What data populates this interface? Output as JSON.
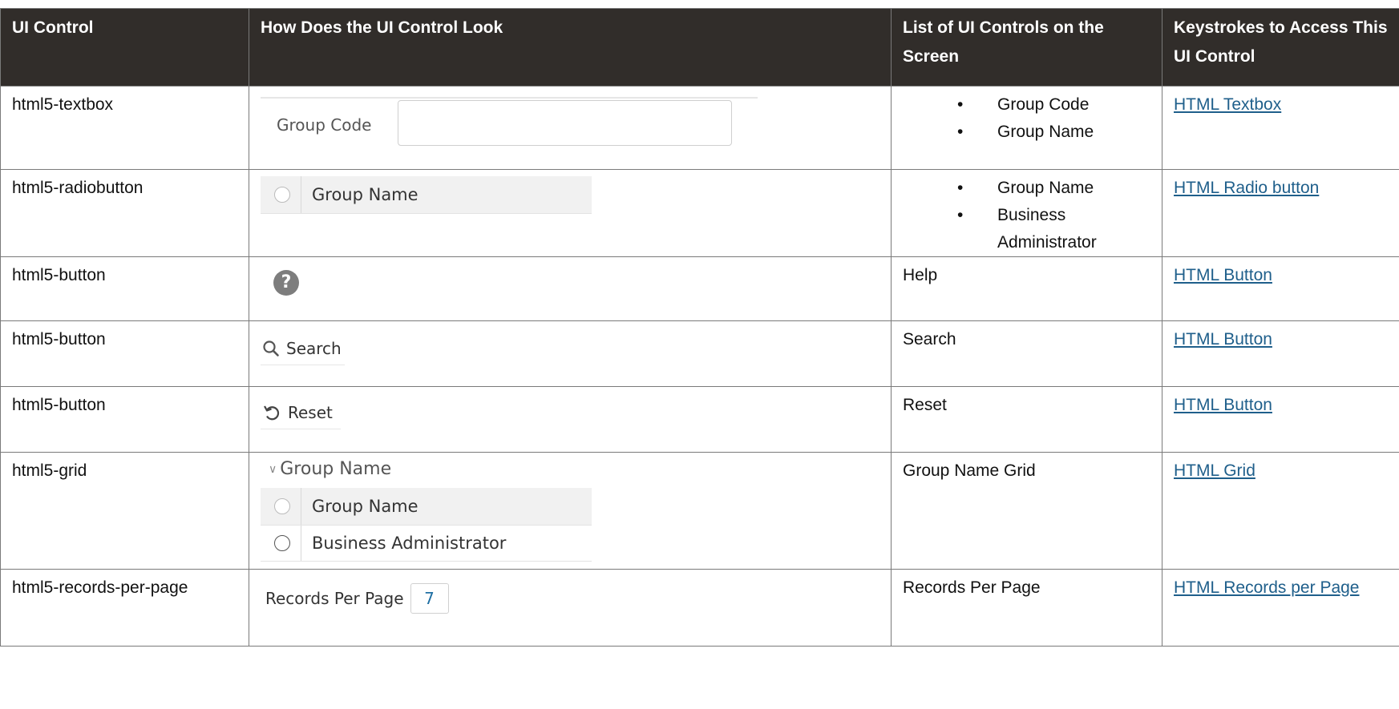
{
  "headers": [
    "UI Control",
    "How Does the UI Control Look",
    "List of UI Controls on the Screen",
    "Keystrokes to Access This UI Control"
  ],
  "rows": [
    {
      "control": "html5-textbox",
      "sample": {
        "label": "Group Code"
      },
      "list": [
        "Group Code",
        "Group Name"
      ],
      "link": "HTML Textbox"
    },
    {
      "control": "html5-radiobutton",
      "sample": {
        "radio_label": "Group Name"
      },
      "list": [
        "Group Name",
        "Business Administrator"
      ],
      "link": "HTML Radio button"
    },
    {
      "control": "html5-button",
      "sample": {
        "icon": "help-icon",
        "glyph": "?"
      },
      "list_text": "Help",
      "link": "HTML Button"
    },
    {
      "control": "html5-button",
      "sample": {
        "icon": "search-icon",
        "label": "Search"
      },
      "list_text": "Search",
      "link": "HTML Button"
    },
    {
      "control": "html5-button",
      "sample": {
        "icon": "reset-icon",
        "label": "Reset"
      },
      "list_text": "Reset",
      "link": "HTML Button"
    },
    {
      "control": "html5-grid",
      "sample": {
        "title": "Group Name",
        "header": "Group Name",
        "row": "Business Administrator"
      },
      "list_text": "Group Name Grid",
      "link": "HTML Grid"
    },
    {
      "control": "html5-records-per-page",
      "sample": {
        "label": "Records Per Page",
        "value": "7"
      },
      "list_text": "Records Per Page",
      "link": "HTML Records per Page"
    }
  ],
  "colors": {
    "header_bg": "#312d2a",
    "link": "#1f5f8b",
    "border": "#7a7a7a"
  }
}
